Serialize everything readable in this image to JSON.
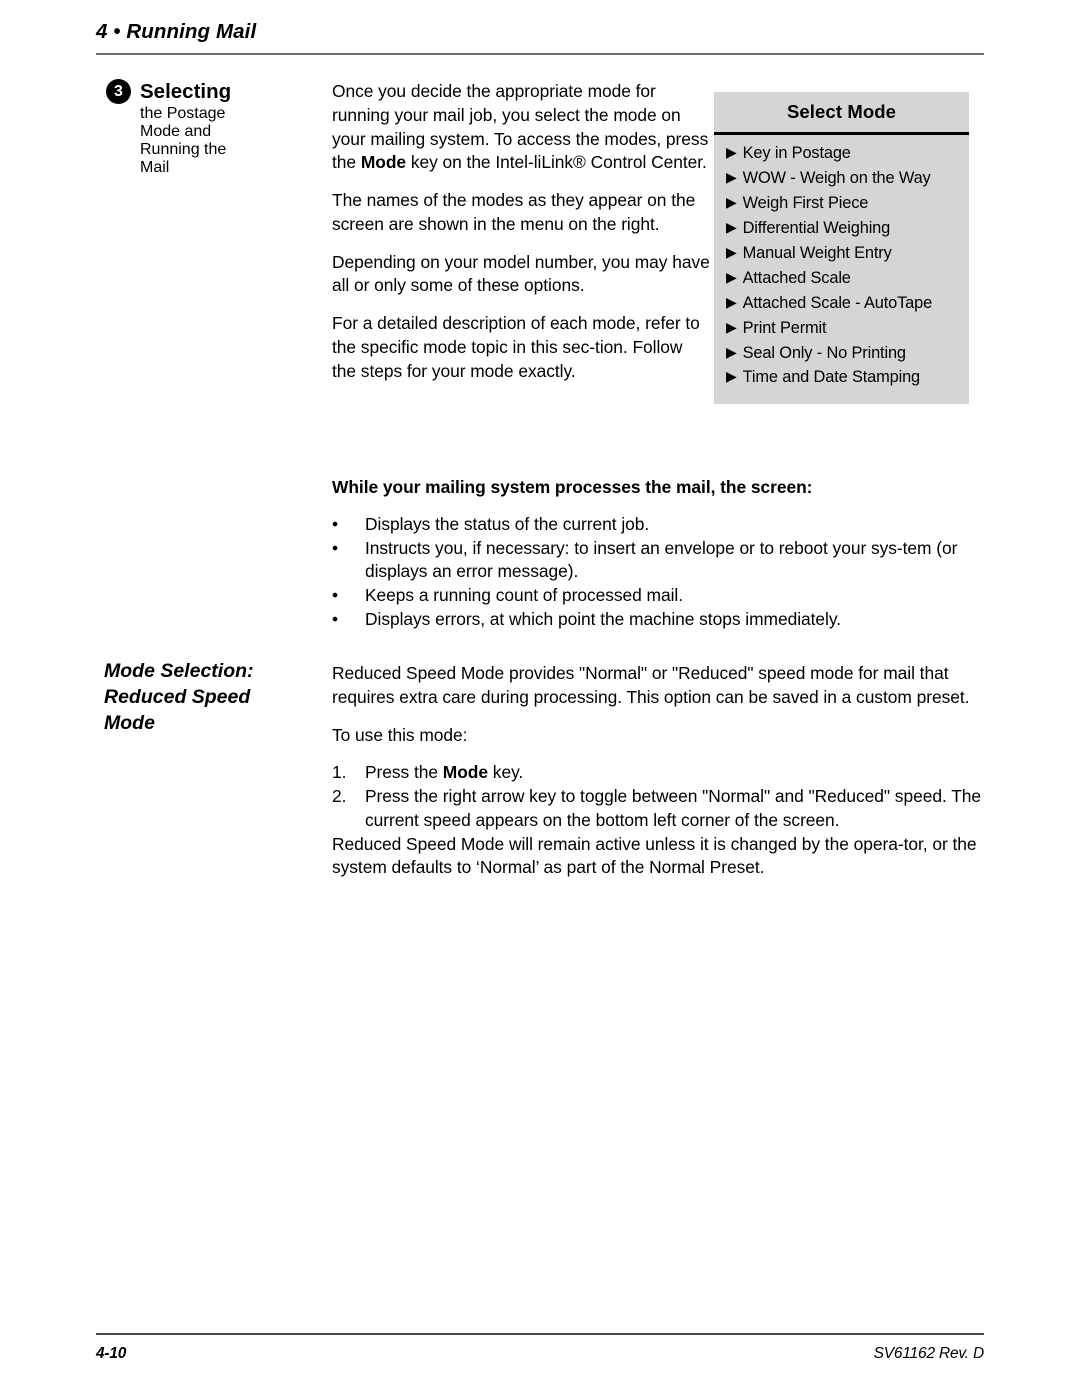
{
  "header": {
    "chapter_title": "4 • Running Mail"
  },
  "footer": {
    "page_number": "4-10",
    "document_id": "SV61162 Rev. D"
  },
  "section": {
    "badge": "3",
    "title_line1": "Selecting",
    "title_line2": "the Postage",
    "title_line3": "Mode and",
    "title_line4": "Running the",
    "title_line5": "Mail",
    "paragraphs": {
      "p1_a": "Once you decide the appropriate mode for running your mail job, you select the mode on your mailing system. To access the modes, press the ",
      "p1_bold": "Mode",
      "p1_b": " key on the Intel-liLink® Control Center.",
      "p2": "The names of the modes as they appear on the screen are shown in the menu on the right.",
      "p3": "Depending on your model number, you may have all or only some of these options.",
      "p4": "For a detailed description of each mode, refer to the specific mode topic in this sec-tion. Follow the steps for your mode exactly."
    }
  },
  "menu": {
    "title": "Select Mode",
    "arrow_glyph": "▶",
    "items": [
      {
        "label": "Key in Postage"
      },
      {
        "label": "WOW - Weigh on the Way"
      },
      {
        "label": "Weigh First Piece"
      },
      {
        "label": "Differential Weighing"
      },
      {
        "label": "Manual Weight Entry"
      },
      {
        "label": "Attached Scale"
      },
      {
        "label": "Attached Scale - AutoTape"
      },
      {
        "label": "Print Permit"
      },
      {
        "label": "Seal Only - No Printing"
      },
      {
        "label": "Time and Date Stamping"
      }
    ]
  },
  "processes": {
    "intro": "While your mailing system processes the mail, the screen:",
    "bullet_glyph": "•",
    "bullets": [
      "Displays the status of the current job.",
      "Instructs you, if necessary:  to insert an envelope or to reboot your sys-tem (or displays an error message).",
      "Keeps a running count of processed mail.",
      "Displays errors, at which point the machine stops immediately."
    ]
  },
  "reduced_speed": {
    "subhead_line1": "Mode Selection:",
    "subhead_line2": "Reduced Speed",
    "subhead_line3": "Mode",
    "intro_paragraph": "Reduced Speed Mode provides \"Normal\" or \"Reduced\" speed mode for mail that requires extra care during processing. This option can be saved in a custom preset.",
    "use_lead": "To use this mode:",
    "steps": [
      {
        "number": "1.",
        "text_a": "Press the ",
        "bold": "Mode",
        "text_b": " key."
      },
      {
        "number": "2.",
        "text_a": "Press the right arrow key to toggle between \"Normal\" and \"Reduced\" speed. The current speed appears on the bottom left corner of the screen.",
        "bold": "",
        "text_b": ""
      }
    ],
    "closing_paragraph": "Reduced Speed Mode will remain active unless it is changed by the opera-tor, or the system defaults to ‘Normal’ as part of the Normal Preset."
  },
  "colors": {
    "menu_background": "#d5d5d5",
    "rule": "#6e6e6e",
    "text": "#000000"
  }
}
